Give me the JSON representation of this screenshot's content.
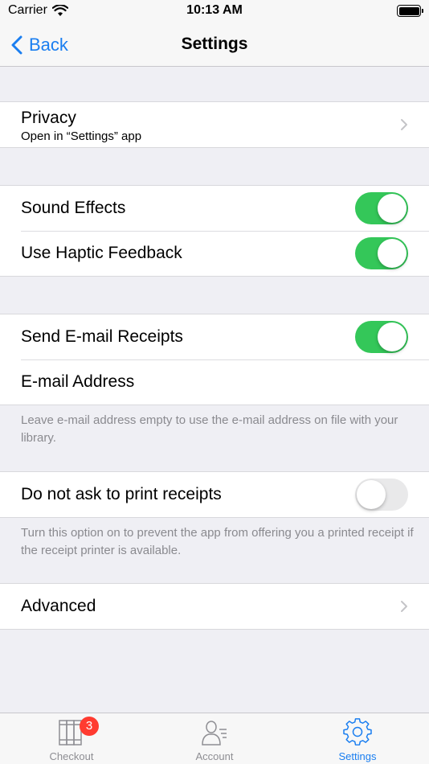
{
  "status": {
    "carrier": "Carrier",
    "time": "10:13 AM"
  },
  "nav": {
    "back_label": "Back",
    "title": "Settings"
  },
  "privacy": {
    "label": "Privacy",
    "subtitle": "Open in “Settings” app"
  },
  "sound_effects": {
    "label": "Sound Effects",
    "on": true
  },
  "haptic": {
    "label": "Use Haptic Feedback",
    "on": true
  },
  "email_receipts": {
    "label": "Send E-mail Receipts",
    "on": true
  },
  "email_address": {
    "label": "E-mail Address",
    "value": ""
  },
  "email_footer": "Leave e-mail address empty to use the e-mail address on file with your library.",
  "no_print": {
    "label": "Do not ask to print receipts",
    "on": false
  },
  "print_footer": "Turn this option on to prevent the app from offering you a printed receipt if the receipt printer is available.",
  "advanced": {
    "label": "Advanced"
  },
  "tabs": [
    {
      "label": "Checkout",
      "icon": "books-icon",
      "badge": "3",
      "active": false
    },
    {
      "label": "Account",
      "icon": "account-icon",
      "active": false
    },
    {
      "label": "Settings",
      "icon": "gear-icon",
      "active": true
    }
  ],
  "colors": {
    "accent": "#1a7ef0",
    "toggle_on": "#34c759",
    "badge": "#ff3b30"
  }
}
